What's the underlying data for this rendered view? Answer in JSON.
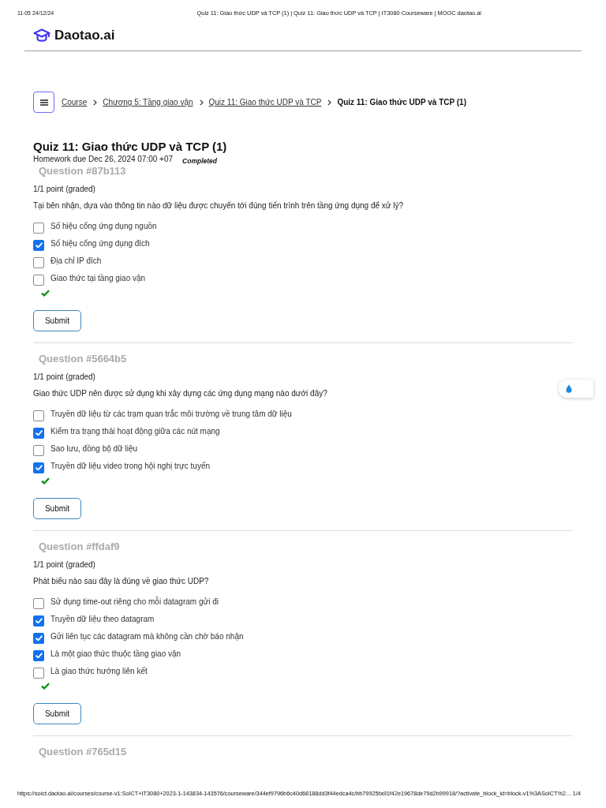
{
  "print_header": {
    "time": "11:05 24/12/24",
    "title": "Quiz 11: Giao thức UDP và TCP (1) | Quiz 11: Giao thức UDP và TCP | IT3080 Courseware | MOOC daotao.ai"
  },
  "site": {
    "logo_text": "Daotao.ai"
  },
  "breadcrumb": [
    {
      "label": "Course",
      "current": false
    },
    {
      "label": "Chương 5: Tầng giao vận",
      "current": false
    },
    {
      "label": "Quiz 11: Giao thức UDP và TCP",
      "current": false
    },
    {
      "label": "Quiz 11: Giao thức UDP và TCP (1)",
      "current": true
    }
  ],
  "quiz": {
    "title": "Quiz 11: Giao thức UDP và TCP (1)",
    "due": "Homework due Dec 26, 2024 07:00 +07",
    "status": "Completed"
  },
  "questions": [
    {
      "heading": "Question #87b113",
      "points": "1/1 point (graded)",
      "prompt": "Tại bên nhận, dựa vào thông tin nào dữ liệu được chuyển tới đúng tiến trình trên tầng ứng dụng để xử lý?",
      "options": [
        {
          "label": "Số hiệu cổng ứng dụng nguồn",
          "checked": false
        },
        {
          "label": "Số hiệu cổng ứng dụng đích",
          "checked": true
        },
        {
          "label": "Địa chỉ IP đích",
          "checked": false
        },
        {
          "label": "Giao thức tại tầng giao vận",
          "checked": false
        }
      ],
      "correct": true,
      "submit_label": "Submit"
    },
    {
      "heading": "Question #5664b5",
      "points": "1/1 point (graded)",
      "prompt": "Giao thức UDP nên được sử dụng khi xây dựng các ứng dụng mạng nào dưới đây?",
      "options": [
        {
          "label": "Truyền dữ liệu từ các trạm quan trắc môi trường về trung tâm dữ liệu",
          "checked": false
        },
        {
          "label": "Kiểm tra trạng thái hoạt động giữa các nút mạng",
          "checked": true
        },
        {
          "label": "Sao lưu, đồng bộ dữ liệu",
          "checked": false
        },
        {
          "label": "Truyền dữ liệu video trong hội nghị trực tuyến",
          "checked": true
        }
      ],
      "correct": true,
      "submit_label": "Submit"
    },
    {
      "heading": "Question #ffdaf9",
      "points": "1/1 point (graded)",
      "prompt": "Phát biểu nào sau đây là đúng về giao thức UDP?",
      "options": [
        {
          "label": "Sử dụng time-out riêng cho mỗi datagram gửi đi",
          "checked": false
        },
        {
          "label": "Truyền dữ liệu theo datagram",
          "checked": true
        },
        {
          "label": "Gửi liên tục các datagram mà không cần chờ báo nhận",
          "checked": true
        },
        {
          "label": "Là một giao thức thuộc tầng giao vận",
          "checked": true
        },
        {
          "label": "Là giao thức hướng liên kết",
          "checked": false
        }
      ],
      "correct": true,
      "submit_label": "Submit"
    },
    {
      "heading": "Question #765d15"
    }
  ],
  "print_footer": {
    "url": "https://soict.daotao.ai/courses/course-v1:SoICT+IT3080+2023-1-143834-143576/courseware/344ef9796b6c40d68188dd3f44edca4c/bb79925fa91f42e19678de79d2b99918/?activate_block_id=block-v1%3ASoICT%2…",
    "page": "1/4"
  }
}
